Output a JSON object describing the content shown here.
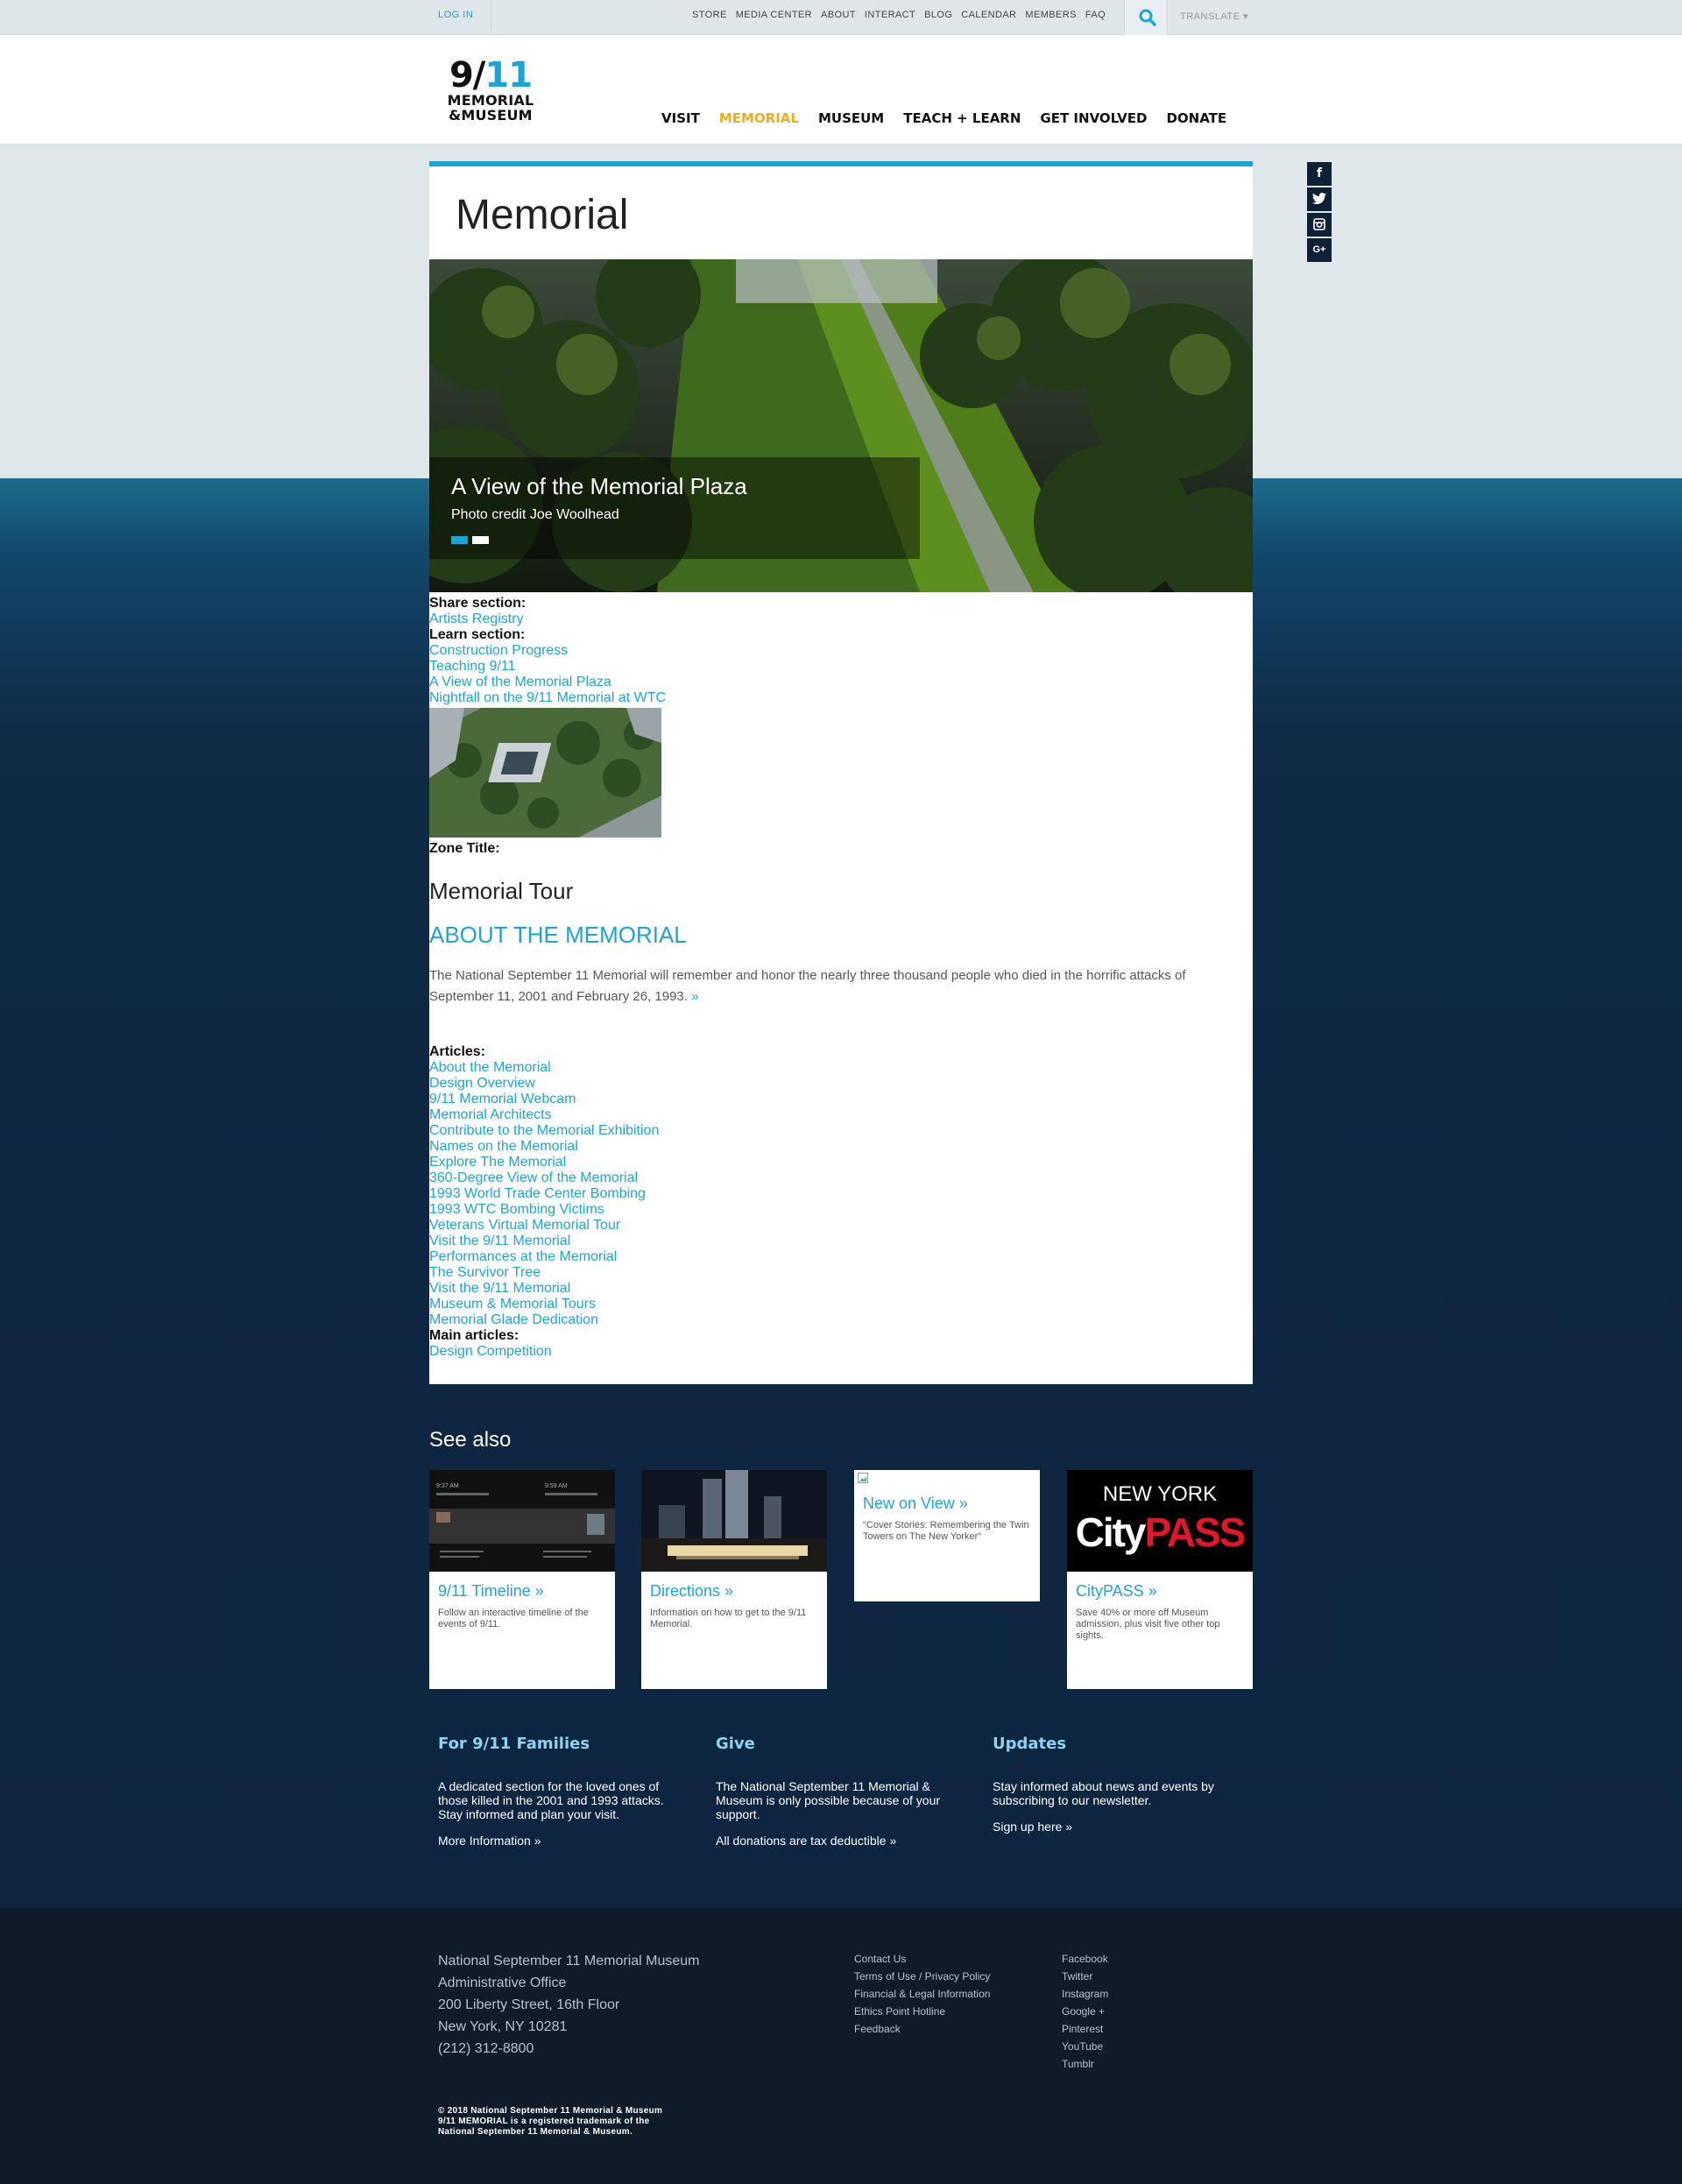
{
  "utility": {
    "login": "LOG IN",
    "links": [
      "STORE",
      "MEDIA CENTER",
      "ABOUT",
      "INTERACT",
      "BLOG",
      "CALENDAR",
      "MEMBERS",
      "FAQ"
    ],
    "translate": "TRANSLATE ▾"
  },
  "logo": {
    "num_a": "9/",
    "num_b": "11",
    "line1": "MEMORIAL",
    "line2": "&MUSEUM"
  },
  "nav": {
    "items": [
      "VISIT",
      "MEMORIAL",
      "MUSEUM",
      "TEACH + LEARN",
      "GET INVOLVED",
      "DONATE"
    ],
    "active_index": 1
  },
  "social": [
    "f",
    "t",
    "ig",
    "G+"
  ],
  "page": {
    "title": "Memorial"
  },
  "hero": {
    "title": "A View of the Memorial Plaza",
    "credit": "Photo credit Joe Woolhead"
  },
  "share_label": "Share section:",
  "share_links": [
    "Artists Registry"
  ],
  "learn_label": "Learn section:",
  "learn_links": [
    "Construction Progress",
    "Teaching 9/11",
    "A View of the Memorial Plaza",
    "Nightfall on the 9/11 Memorial at WTC"
  ],
  "zone_label": "Zone Title:",
  "tour_title": "Memorial Tour",
  "about": {
    "title": "ABOUT THE MEMORIAL",
    "text": "The National September 11 Memorial will remember and honor the nearly three thousand people who died in the horrific attacks of September 11, 2001 and February 26, 1993.",
    "more": "»"
  },
  "articles_label": "Articles:",
  "articles": [
    "About the Memorial",
    "Design Overview",
    "9/11 Memorial Webcam",
    "Memorial Architects",
    "Contribute to the Memorial Exhibition",
    "Names on the Memorial",
    "Explore The Memorial",
    "360-Degree View of the Memorial",
    "1993 World Trade Center Bombing",
    "1993 WTC Bombing Victims",
    "Veterans Virtual Memorial Tour",
    "Visit the 9/11 Memorial",
    "Performances at the Memorial",
    "The Survivor Tree",
    "Visit the 9/11 Memorial",
    "Museum & Memorial Tours",
    "Memorial Glade Dedication"
  ],
  "main_articles_label": "Main articles:",
  "main_articles": [
    "Design Competition"
  ],
  "see_also": {
    "title": "See also",
    "cards": [
      {
        "title": "9/11 Timeline »",
        "desc": "Follow an interactive timeline of the events of 9/11."
      },
      {
        "title": "Directions »",
        "desc": "Information on how to get to the 9/11 Memorial."
      },
      {
        "title": "New on View »",
        "desc": "\"Cover Stories: Remembering the Twin Towers on The New Yorker\""
      },
      {
        "title": "CityPASS »",
        "desc": "Save 40% or more off Museum admission, plus visit five other top sights.",
        "banner_a": "NEW YORK",
        "banner_b": "City",
        "banner_c": "PASS"
      }
    ],
    "timeline_times": [
      "9:37 AM",
      "9:59 AM"
    ]
  },
  "info": [
    {
      "title": "For 9/11 Families",
      "text": "A dedicated section for the loved ones of those killed in the 2001 and 1993 attacks. Stay informed and plan your visit.",
      "link": "More Information »"
    },
    {
      "title": "Give",
      "text": "The National September 11 Memorial & Museum is only possible because of your support.",
      "link": "All donations are tax deductible »"
    },
    {
      "title": "Updates",
      "text": "Stay informed about news and events by subscribing to our newsletter.",
      "link": "Sign up here »"
    }
  ],
  "footer": {
    "address": [
      "National September 11 Memorial Museum",
      "Administrative Office",
      "200 Liberty Street, 16th Floor",
      "New York, NY 10281",
      "(212) 312-8800"
    ],
    "links1": [
      "Contact Us",
      "Terms of Use / Privacy Policy",
      "Financial & Legal Information",
      "Ethics Point Hotline",
      "Feedback"
    ],
    "links2": [
      "Facebook",
      "Twitter",
      "Instagram",
      "Google +",
      "Pinterest",
      "YouTube",
      "Tumblr"
    ],
    "copyright": [
      "© 2018 National September 11 Memorial & Museum",
      "9/11 MEMORIAL is a registered trademark of the",
      "National September 11 Memorial & Museum."
    ]
  },
  "colors": {
    "accent": "#1ea3d7",
    "nav_active": "#f0ac1b",
    "navy": "#0e2742",
    "footer": "#0e1b29"
  }
}
